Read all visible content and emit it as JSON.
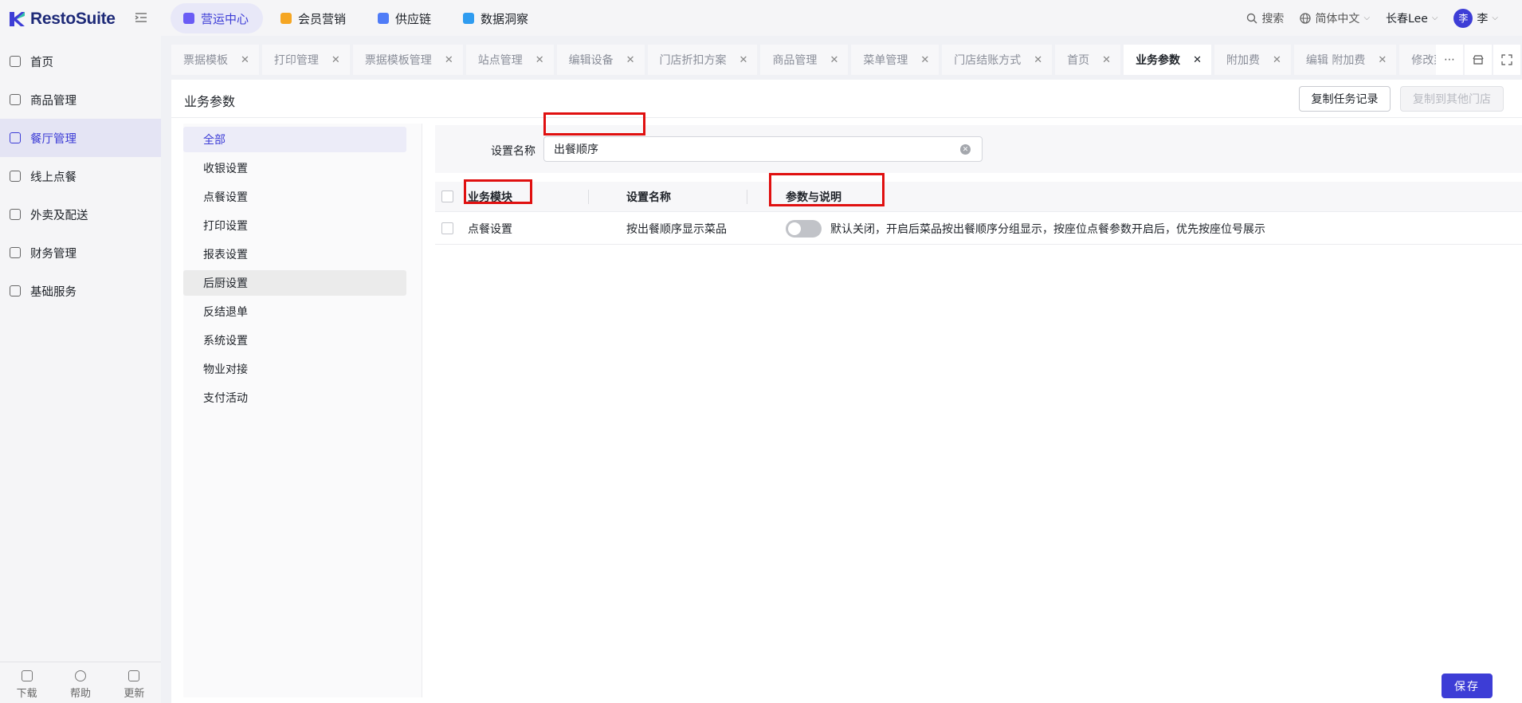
{
  "app": {
    "name": "RestoSuite"
  },
  "topnav": [
    {
      "label": "营运中心",
      "active": true,
      "color": "#6a5cf5"
    },
    {
      "label": "会员营销",
      "active": false,
      "color": "#f5a623"
    },
    {
      "label": "供应链",
      "active": false,
      "color": "#4f7cf7"
    },
    {
      "label": "数据洞察",
      "active": false,
      "color": "#2f9cf0"
    }
  ],
  "header": {
    "search_label": "搜索",
    "language": "简体中文",
    "store": "长春Lee",
    "user_avatar": "李",
    "user_name": "李"
  },
  "sidebar": {
    "items": [
      {
        "label": "首页",
        "active": false
      },
      {
        "label": "商品管理",
        "active": false
      },
      {
        "label": "餐厅管理",
        "active": true
      },
      {
        "label": "线上点餐",
        "active": false
      },
      {
        "label": "外卖及配送",
        "active": false
      },
      {
        "label": "财务管理",
        "active": false
      },
      {
        "label": "基础服务",
        "active": false
      }
    ],
    "bottom": [
      {
        "label": "下载"
      },
      {
        "label": "帮助"
      },
      {
        "label": "更新"
      }
    ]
  },
  "tabs": [
    {
      "label": "票据模板",
      "active": false
    },
    {
      "label": "打印管理",
      "active": false
    },
    {
      "label": "票据模板管理",
      "active": false
    },
    {
      "label": "站点管理",
      "active": false
    },
    {
      "label": "编辑设备",
      "active": false
    },
    {
      "label": "门店折扣方案",
      "active": false
    },
    {
      "label": "商品管理",
      "active": false
    },
    {
      "label": "菜单管理",
      "active": false
    },
    {
      "label": "门店结账方式",
      "active": false
    },
    {
      "label": "首页",
      "active": false
    },
    {
      "label": "业务参数",
      "active": true
    },
    {
      "label": "附加费",
      "active": false
    },
    {
      "label": "编辑 附加费",
      "active": false
    },
    {
      "label": "修改菜单",
      "active": false
    }
  ],
  "page": {
    "title": "业务参数",
    "copy_task_button": "复制任务记录",
    "copy_other_store_button": "复制到其他门店",
    "save_button": "保存"
  },
  "categories": [
    {
      "label": "全部",
      "state": "active"
    },
    {
      "label": "收银设置",
      "state": ""
    },
    {
      "label": "点餐设置",
      "state": ""
    },
    {
      "label": "打印设置",
      "state": ""
    },
    {
      "label": "报表设置",
      "state": ""
    },
    {
      "label": "后厨设置",
      "state": "hover"
    },
    {
      "label": "反结退单",
      "state": ""
    },
    {
      "label": "系统设置",
      "state": ""
    },
    {
      "label": "物业对接",
      "state": ""
    },
    {
      "label": "支付活动",
      "state": ""
    }
  ],
  "filter": {
    "label": "设置名称",
    "value": "出餐顺序"
  },
  "table": {
    "headers": [
      "业务模块",
      "设置名称",
      "参数与说明"
    ],
    "rows": [
      {
        "module": "点餐设置",
        "name": "按出餐顺序显示菜品",
        "enabled": false,
        "description": "默认关闭，开启后菜品按出餐顺序分组显示，按座位点餐参数开启后，优先按座位号展示"
      }
    ]
  },
  "colors": {
    "accent": "#3d3dd6",
    "highlight": "#e01010"
  }
}
